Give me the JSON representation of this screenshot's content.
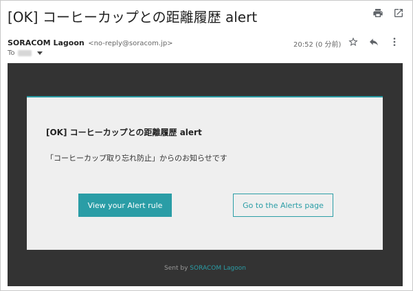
{
  "email": {
    "subject": "[OK] コーヒーカップとの距離履歴 alert",
    "sender_name": "SORACOM Lagoon",
    "sender_email": "<no-reply@soracom.jp>",
    "to_label": "To",
    "time": "20:52 (0 分前)"
  },
  "content": {
    "title": "[OK] コーヒーカップとの距離履歴 alert",
    "message": "「コーヒーカップ取り忘れ防止」からのお知らせです",
    "primary_button": "View your Alert rule",
    "secondary_button": "Go to the Alerts page",
    "footer_prefix": "Sent by ",
    "footer_brand": "SORACOM Lagoon"
  },
  "icons": {
    "print": "print-icon",
    "open_new": "open-in-new-icon",
    "star": "star-icon",
    "reply": "reply-icon",
    "more": "more-vert-icon",
    "dropdown": "chevron-down-icon"
  },
  "colors": {
    "accent": "#2a9da6",
    "email_background": "#333333",
    "card_background": "#efefef"
  }
}
